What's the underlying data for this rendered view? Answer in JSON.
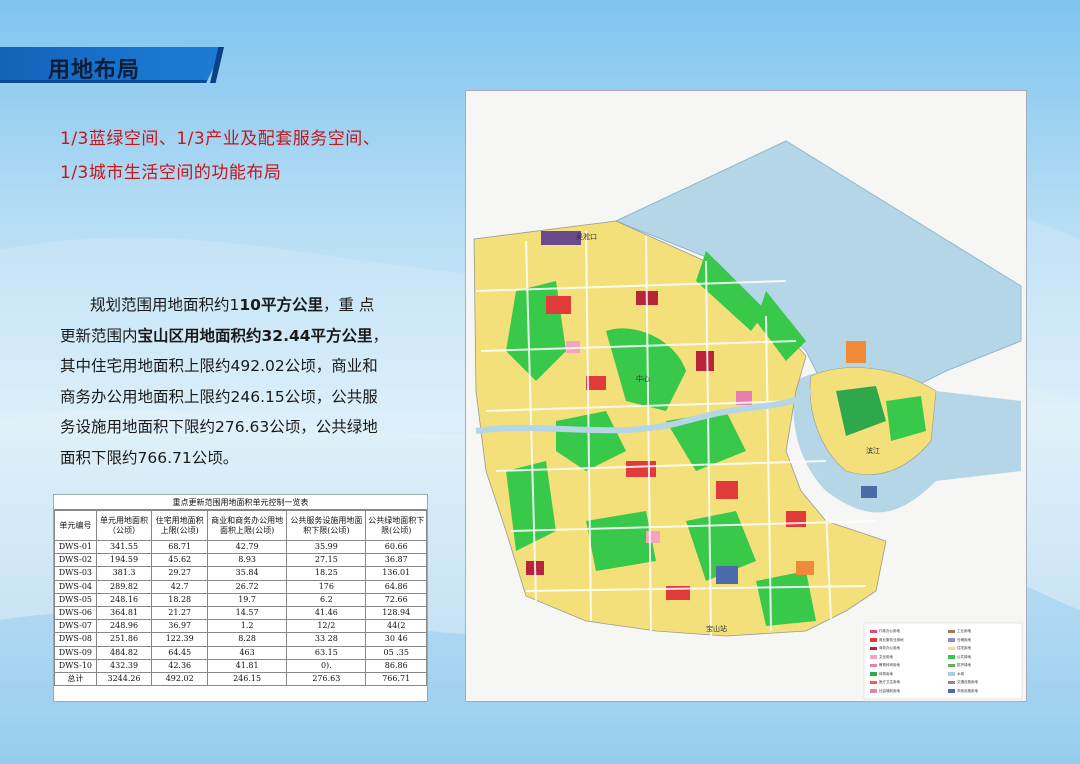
{
  "page": {
    "title": "用地布局",
    "subtitle_line1": "1/3蓝绿空间、1/3产业及配套服务空间、",
    "subtitle_line2": "1/3城市生活空间的功能布局"
  },
  "body": {
    "p1": "规划范围用地面积约1",
    "p1_bold": "10平方公里",
    "p1_rest": "，重 点",
    "p2": "更新范围内",
    "p2_bold": "宝山区用地面积约32.44平方公里",
    "p2_rest": "，",
    "p3": "其中住宅用地面积上限约492.02公顷，商业和",
    "p4": "商务办公用地面积上限约246.15公顷，公共服",
    "p5": "务设施用地面积下限约276.63公顷，公共绿地",
    "p6": "面积下限约766.71公顷。"
  },
  "table": {
    "title": "重点更新范围用地面积单元控制一览表",
    "headers": [
      "单元编号",
      "单元用地面积（公顷）",
      "住宅用地面积上限(公顷)",
      "商业和商务办公用地面积上限(公顷)",
      "公共服务设施用地面积下限(公顷)",
      "公共绿地面积下限(公顷)"
    ],
    "rows": [
      [
        "DWS-01",
        "341.55",
        "68.71",
        "42.79",
        "35.99",
        "60.66"
      ],
      [
        "DWS-02",
        "194.59",
        "45.62",
        "8.93",
        "27.15",
        "36.87"
      ],
      [
        "DWS-03",
        "381.3",
        "29.27",
        "35.84",
        "18.25",
        "136.01"
      ],
      [
        "DWS-04",
        "289.82",
        "42.7",
        "26.72",
        "176",
        "64.86"
      ],
      [
        "DWS-05",
        "248.16",
        "18.28",
        "19.7",
        "6.2",
        "72.66"
      ],
      [
        "DWS-06",
        "364.81",
        "21.27",
        "14.57",
        "41.46",
        "128.94"
      ],
      [
        "DWS-07",
        "248.96",
        "36.97",
        "1.2",
        "12/2",
        "44(2"
      ],
      [
        "DWS-08",
        "251.86",
        "122.39",
        "8.28",
        "33 28",
        "30 46"
      ],
      [
        "DWS-09",
        "484.82",
        "64.45",
        "463",
        "63.15",
        "05 .35"
      ],
      [
        "DWS-10",
        "432.39",
        "42.36",
        "41.81",
        "0).",
        "86.86"
      ],
      [
        "总计",
        "3244.26",
        "492.02",
        "246.15",
        "276.63",
        "766.71"
      ]
    ]
  },
  "map": {
    "labels": {
      "south_station": "宝山站",
      "north_area": "吴淞口",
      "east_area": "滨江",
      "center": "中心"
    },
    "legend": [
      {
        "label": "行政办公用地",
        "color": "#e8467c"
      },
      {
        "label": "商业服务业用地",
        "color": "#e03a3a"
      },
      {
        "label": "商务办公用地",
        "color": "#b8253a"
      },
      {
        "label": "文化用地",
        "color": "#f4a3c0"
      },
      {
        "label": "教育科研用地",
        "color": "#e47fb0"
      },
      {
        "label": "体育用地",
        "color": "#2ea84a"
      },
      {
        "label": "医疗卫生用地",
        "color": "#f05a5a"
      },
      {
        "label": "社会福利用地",
        "color": "#d88a9e"
      },
      {
        "label": "工业用地",
        "color": "#a0785a"
      },
      {
        "label": "仓储用地",
        "color": "#9a87c0"
      },
      {
        "label": "住宅用地",
        "color": "#f3e07a"
      },
      {
        "label": "公共绿地",
        "color": "#38c84a"
      },
      {
        "label": "防护绿地",
        "color": "#6fa85a"
      },
      {
        "label": "水域",
        "color": "#a8cfe2"
      },
      {
        "label": "交通设施用地",
        "color": "#8c8c8c"
      },
      {
        "label": "市政设施用地",
        "color": "#4a6aa8"
      }
    ]
  },
  "colors": {
    "title_band": "#1a77d0",
    "subtitle": "#c4161c",
    "residential": "#f3e07a",
    "green": "#38c84a",
    "commercial": "#e03a3a",
    "water": "#b5d6e6"
  }
}
